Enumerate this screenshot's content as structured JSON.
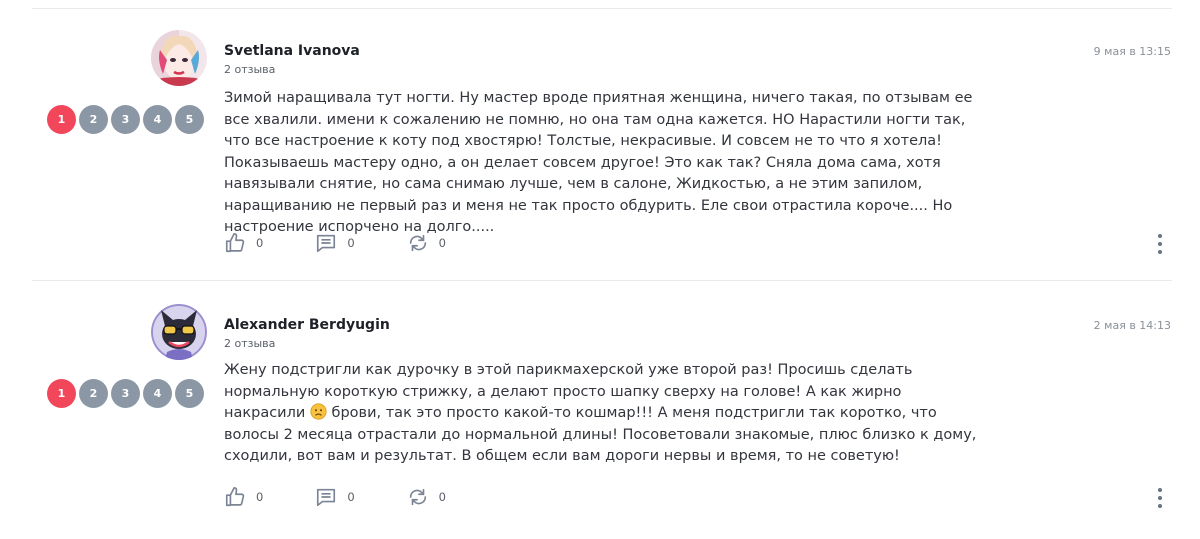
{
  "reviews": [
    {
      "author": "Svetlana Ivanova",
      "reviews_count": "2 отзыва",
      "date": "9 мая в 13:15",
      "rating_options": [
        "1",
        "2",
        "3",
        "4",
        "5"
      ],
      "rating_value": 1,
      "text": "Зимой наращивала тут ногти. Ну мастер вроде приятная женщина, ничего такая, по отзывам ее все хвалили. имени к сожалению не помню, но она там одна кажется. НО Нарастили ногти так, что все настроение к коту под хвостярю! Толстые, некрасивые. И совсем не то что я хотела! Показываешь мастеру одно, а он делает совсем другое! Это как так? Сняла дома сама, хотя навязывали снятие, но сама снимаю лучше, чем в салоне, Жидкостью, а не этим запилом, наращиванию не первый раз и меня не так просто обдурить. Еле свои отрастила короче.... Но настроение испорчено на долго.....",
      "likes": "0",
      "comments": "0",
      "reposts": "0",
      "avatar_icon": "harley-quinn-avatar"
    },
    {
      "author": "Alexander Berdyugin",
      "reviews_count": "2 отзыва",
      "date": "2 мая в 14:13",
      "rating_options": [
        "1",
        "2",
        "3",
        "4",
        "5"
      ],
      "rating_value": 1,
      "text_before_emoji": "Жену подстригли как дурочку в этой парикмахерской уже второй раз! Просишь сделать нормальную короткую стрижку, а делают просто шапку сверху на голове! А как жирно накрасили ",
      "emoji_icon": "worried-face-emoji",
      "text_after_emoji": " брови, так это просто какой-то кошмар!!! А меня подстригли так коротко, что волосы 2 месяца отрастали до нормальной длины! Посоветовали знакомые, плюс близко к дому, сходили, вот вам и результат. В общем если вам дороги нервы и время, то не советую!",
      "likes": "0",
      "comments": "0",
      "reposts": "0",
      "avatar_icon": "cartoon-cat-sunglasses-avatar"
    }
  ],
  "colors": {
    "rating_active": "#f2465b",
    "rating_inactive": "#8c97a6",
    "icon": "#7b8494"
  }
}
